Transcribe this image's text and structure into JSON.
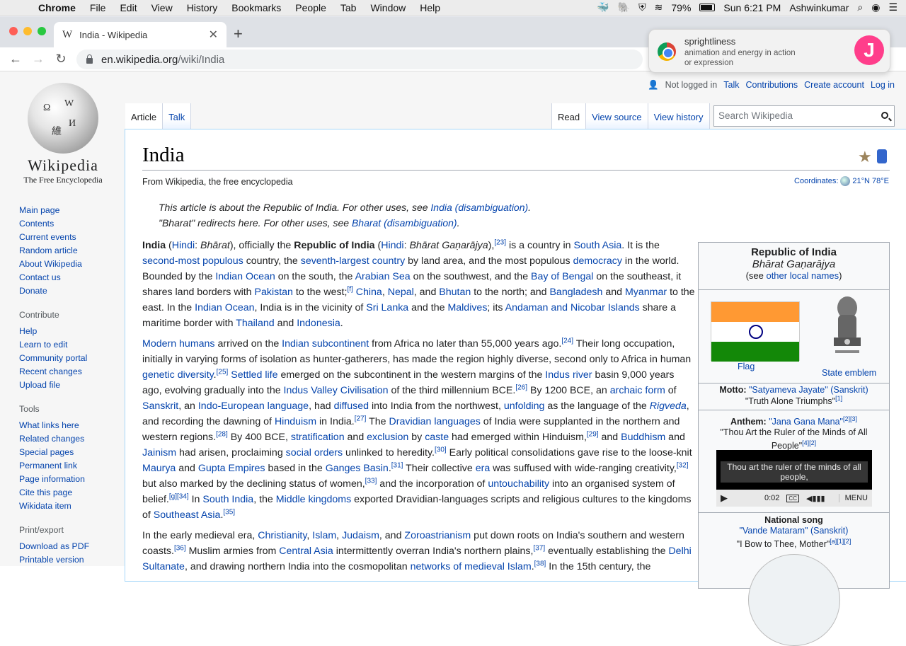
{
  "menubar": {
    "items": [
      "Chrome",
      "File",
      "Edit",
      "View",
      "History",
      "Bookmarks",
      "People",
      "Tab",
      "Window",
      "Help"
    ],
    "battery": "79%",
    "clock": "Sun 6:21 PM",
    "user": "Ashwinkumar"
  },
  "browser": {
    "tab_title": "India - Wikipedia",
    "url_host": "en.wikipedia.org",
    "url_path": "/wiki/India"
  },
  "notification": {
    "title": "sprightliness",
    "body_line1": "animation and energy in action",
    "body_line2": "or expression"
  },
  "wiki": {
    "wordmark": "Wikipedia",
    "tagline": "The Free Encyclopedia",
    "nav": [
      "Main page",
      "Contents",
      "Current events",
      "Random article",
      "About Wikipedia",
      "Contact us",
      "Donate"
    ],
    "contribute_heading": "Contribute",
    "contribute": [
      "Help",
      "Learn to edit",
      "Community portal",
      "Recent changes",
      "Upload file"
    ],
    "tools_heading": "Tools",
    "tools": [
      "What links here",
      "Related changes",
      "Special pages",
      "Permanent link",
      "Page information",
      "Cite this page",
      "Wikidata item"
    ],
    "print_heading": "Print/export",
    "print": [
      "Download as PDF",
      "Printable version"
    ],
    "personal": {
      "not_logged": "Not logged in",
      "talk": "Talk",
      "contributions": "Contributions",
      "create": "Create account",
      "login": "Log in"
    },
    "tabs": {
      "article": "Article",
      "talk": "Talk",
      "read": "Read",
      "view_source": "View source",
      "view_history": "View history"
    },
    "search_placeholder": "Search Wikipedia",
    "title": "India",
    "from": "From Wikipedia, the free encyclopedia",
    "coords_label": "Coordinates:",
    "coords_value": "21°N 78°E",
    "hatnote1": "This article is about the Republic of India. For other uses, see",
    "hatnote1_link": "India (disambiguation)",
    "hatnote2": "\"Bharat\" redirects here. For other uses, see",
    "hatnote2_link": "Bharat (disambiguation)"
  },
  "infobox": {
    "title": "Republic of India",
    "native": "Bhārat Gaṇarājya",
    "see_pre": "(see ",
    "see_link": "other local names",
    "see_post": ")",
    "flag_caption": "Flag",
    "emblem_caption": "State emblem",
    "motto_label": "Motto:",
    "motto": "\"Satyameva Jayate\"",
    "motto_lang": "(Sanskrit)",
    "motto_trans": "\"Truth Alone Triumphs\"",
    "anthem_label": "Anthem:",
    "anthem": "\"Jana Gana Mana\"",
    "anthem_trans": "\"Thou Art the Ruler of the Minds of All People\"",
    "player_caption": "Thou art the ruler of the minds of all people,",
    "player_time": "0:02",
    "player_menu": "MENU",
    "song_label": "National song",
    "song": "\"Vande Mataram\"",
    "song_lang": "(Sanskrit)",
    "song_trans": "\"I Bow to Thee, Mother\""
  },
  "colors": {
    "link": "#0645ad",
    "saffron": "#ff9933",
    "green": "#138808",
    "navy": "#000080"
  }
}
